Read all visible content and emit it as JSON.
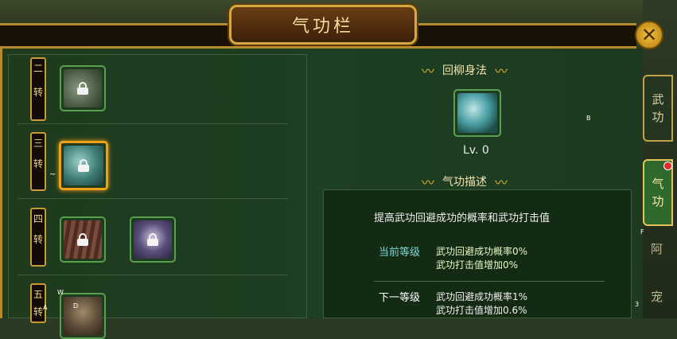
{
  "window": {
    "title": "气功栏",
    "close_icon": "close-icon"
  },
  "left_panel": {
    "tiers": [
      {
        "label": "二转",
        "chars": [
          "二",
          "转"
        ],
        "skills": [
          {
            "locked": true,
            "selected": false
          }
        ]
      },
      {
        "label": "三转",
        "chars": [
          "三",
          "转"
        ],
        "skills": [
          {
            "locked": true,
            "selected": true
          }
        ]
      },
      {
        "label": "四转",
        "chars": [
          "四",
          "转"
        ],
        "skills": [
          {
            "locked": true,
            "selected": false
          },
          {
            "locked": true,
            "selected": false
          }
        ]
      },
      {
        "label": "五转",
        "chars": [
          "五",
          "转"
        ],
        "skills": [
          {
            "locked": true,
            "selected": false
          }
        ]
      }
    ]
  },
  "right_panel": {
    "skill_name": "回柳身法",
    "level": "Lv. 0",
    "desc_header": "气功描述",
    "description": "提高武功回避成功的概率和武功打击值",
    "current": {
      "label": "当前等级",
      "lines": [
        "武功回避成功概率0%",
        "武功打击值增加0%"
      ]
    },
    "next": {
      "label": "下一等级",
      "lines": [
        "武功回避成功概率1%",
        "武功打击值增加0.6%"
      ]
    }
  },
  "side_tabs": [
    {
      "chars": [
        "武",
        "功"
      ],
      "active": false
    },
    {
      "chars": [
        "气",
        "功"
      ],
      "active": true
    }
  ],
  "overlay_letters": {
    "b": "B",
    "f": "F",
    "w": "W",
    "a": "A",
    "d": "D",
    "three": "3",
    "tilde": "~"
  },
  "side_glyphs": [
    "阿",
    "宠"
  ],
  "colors": {
    "gold": "#d6a93e",
    "selected_border": "#f0a018",
    "current_label": "#7fd6d6",
    "next_label": "#ffffff",
    "panel_green": "#1d3f22"
  }
}
